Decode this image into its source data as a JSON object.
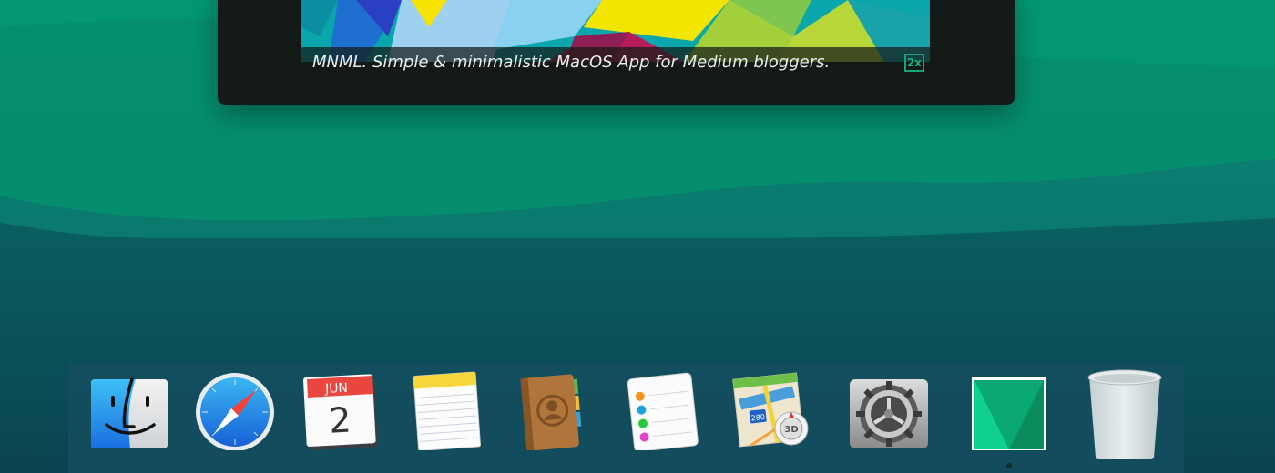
{
  "preview": {
    "caption": "MNML. Simple & minimalistic MacOS App for Medium bloggers.",
    "zoom_badge": "2x"
  },
  "dock": {
    "items": [
      {
        "name": "Finder",
        "icon": "finder-icon"
      },
      {
        "name": "Safari",
        "icon": "safari-compass-icon"
      },
      {
        "name": "Calendar",
        "icon": "calendar-icon",
        "month": "JUN",
        "day": "2"
      },
      {
        "name": "Notes",
        "icon": "notes-icon"
      },
      {
        "name": "Contacts",
        "icon": "contacts-book-icon"
      },
      {
        "name": "Reminders",
        "icon": "reminders-icon"
      },
      {
        "name": "Maps",
        "icon": "maps-icon",
        "route_shield": "280",
        "view_button": "3D"
      },
      {
        "name": "System Preferences",
        "icon": "gear-icon"
      },
      {
        "name": "MNML",
        "icon": "mnml-logo-icon",
        "running": true
      },
      {
        "name": "Trash",
        "icon": "trash-icon"
      }
    ]
  },
  "colors": {
    "wallpaper_light": "#04926e",
    "wallpaper_dark": "#0a4a54",
    "dock_background": "#164e60",
    "window_background": "#131a18",
    "badge_accent": "#15a57a",
    "mnml_green_light": "#0fd08d",
    "mnml_green_dark": "#0a8c5c"
  }
}
